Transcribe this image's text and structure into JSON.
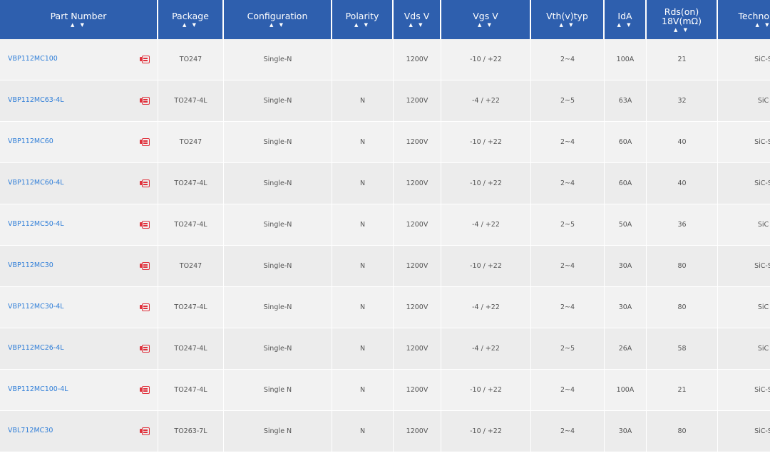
{
  "table": {
    "columns": [
      {
        "label": "Part Number"
      },
      {
        "label": "Package"
      },
      {
        "label": "Configuration"
      },
      {
        "label": "Polarity"
      },
      {
        "label": "Vds V"
      },
      {
        "label": "Vgs V"
      },
      {
        "label": "Vth(v)typ"
      },
      {
        "label": "IdA"
      },
      {
        "label": "Rds(on)",
        "label2": "18V(mΩ)"
      },
      {
        "label": "Technology"
      }
    ],
    "sort_glyph": "▲ ▼",
    "rows": [
      {
        "part": "VBP112MC100",
        "package": "TO247",
        "configuration": "Single-N",
        "polarity": "",
        "vds": "1200V",
        "vgs": "-10 / +22",
        "vth": "2~4",
        "id": "100A",
        "rds": "21",
        "technology": "SiC-S"
      },
      {
        "part": "VBP112MC63-4L",
        "package": "TO247-4L",
        "configuration": "Single-N",
        "polarity": "N",
        "vds": "1200V",
        "vgs": "-4 / +22",
        "vth": "2~5",
        "id": "63A",
        "rds": "32",
        "technology": "SiC"
      },
      {
        "part": "VBP112MC60",
        "package": "TO247",
        "configuration": "Single-N",
        "polarity": "N",
        "vds": "1200V",
        "vgs": "-10 / +22",
        "vth": "2~4",
        "id": "60A",
        "rds": "40",
        "technology": "SiC-S"
      },
      {
        "part": "VBP112MC60-4L",
        "package": "TO247-4L",
        "configuration": "Single-N",
        "polarity": "N",
        "vds": "1200V",
        "vgs": "-10 / +22",
        "vth": "2~4",
        "id": "60A",
        "rds": "40",
        "technology": "SiC-S"
      },
      {
        "part": "VBP112MC50-4L",
        "package": "TO247-4L",
        "configuration": "Single-N",
        "polarity": "N",
        "vds": "1200V",
        "vgs": "-4 / +22",
        "vth": "2~5",
        "id": "50A",
        "rds": "36",
        "technology": "SiC"
      },
      {
        "part": "VBP112MC30",
        "package": "TO247",
        "configuration": "Single-N",
        "polarity": "N",
        "vds": "1200V",
        "vgs": "-10 / +22",
        "vth": "2~4",
        "id": "30A",
        "rds": "80",
        "technology": "SiC-S"
      },
      {
        "part": "VBP112MC30-4L",
        "package": "TO247-4L",
        "configuration": "Single-N",
        "polarity": "N",
        "vds": "1200V",
        "vgs": "-4 / +22",
        "vth": "2~4",
        "id": "30A",
        "rds": "80",
        "technology": "SiC"
      },
      {
        "part": "VBP112MC26-4L",
        "package": "TO247-4L",
        "configuration": "Single-N",
        "polarity": "N",
        "vds": "1200V",
        "vgs": "-4 / +22",
        "vth": "2~5",
        "id": "26A",
        "rds": "58",
        "technology": "SiC"
      },
      {
        "part": "VBP112MC100-4L",
        "package": "TO247-4L",
        "configuration": "Single N",
        "polarity": "N",
        "vds": "1200V",
        "vgs": "-10 / +22",
        "vth": "2~4",
        "id": "100A",
        "rds": "21",
        "technology": "SiC-S"
      },
      {
        "part": "VBL712MC30",
        "package": "TO263-7L",
        "configuration": "Single N",
        "polarity": "N",
        "vds": "1200V",
        "vgs": "-10 / +22",
        "vth": "2~4",
        "id": "30A",
        "rds": "80",
        "technology": "SiC-S"
      }
    ]
  },
  "icons": {
    "datasheet": "pdf-icon"
  },
  "colors": {
    "header_bg": "#2e5fae",
    "link": "#2f7ed8",
    "pdf_icon": "#e0303b"
  }
}
